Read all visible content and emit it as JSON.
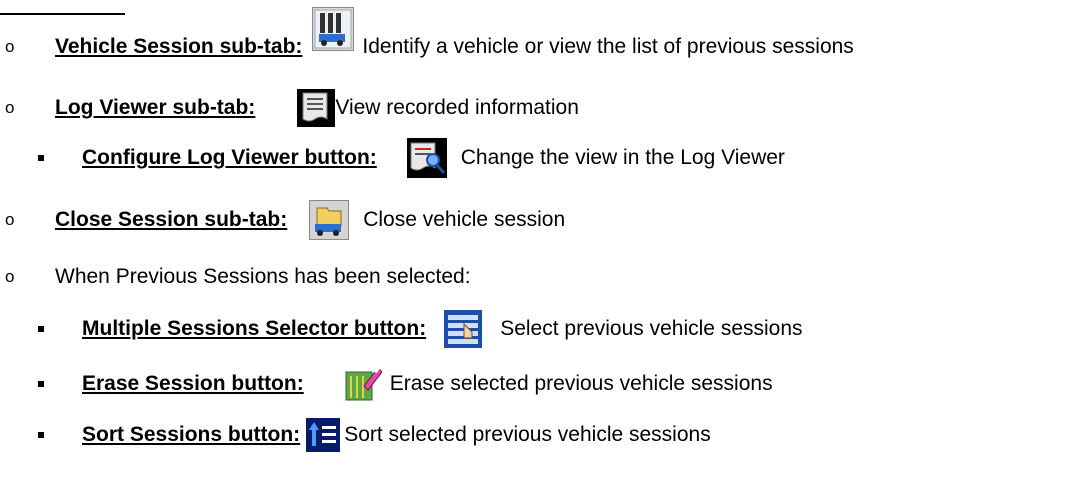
{
  "items": [
    {
      "term": "Vehicle Session sub-tab:",
      "desc": "Identify a vehicle or view the list of previous sessions",
      "icon": "vehicle-session-icon"
    },
    {
      "term": "Log Viewer sub-tab:",
      "desc": "View recorded information",
      "icon": "log-viewer-icon"
    },
    {
      "term": "Configure Log Viewer button:",
      "desc": "Change the view in the Log Viewer",
      "icon": "configure-log-viewer-icon"
    },
    {
      "term": "Close Session sub-tab:",
      "desc": "Close vehicle session",
      "icon": "close-session-icon"
    },
    {
      "text": "When Previous Sessions has been selected:"
    },
    {
      "term": "Multiple Sessions Selector button:",
      "desc": "Select previous vehicle sessions",
      "icon": "multiple-sessions-selector-icon"
    },
    {
      "term": "Erase Session button:",
      "desc": "Erase selected previous vehicle sessions",
      "icon": "erase-session-icon"
    },
    {
      "term": "Sort Sessions button:",
      "desc": "Sort selected previous vehicle sessions",
      "icon": "sort-sessions-icon"
    }
  ],
  "bullets": {
    "level1": "o"
  }
}
